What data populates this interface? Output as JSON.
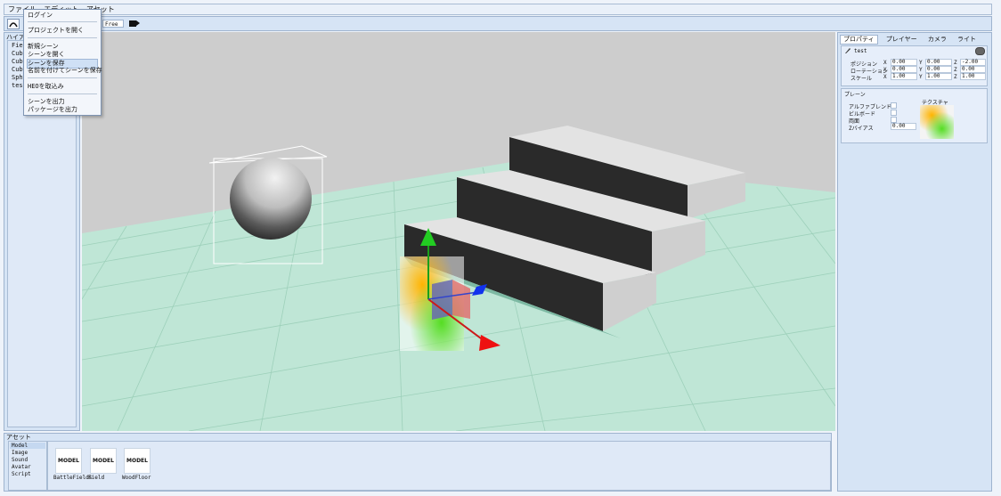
{
  "menubar": {
    "items": [
      "ファイル",
      "エディット",
      "アセット"
    ]
  },
  "toolbar": {
    "camera_mode": "Free"
  },
  "hierarchy": {
    "title": "ハイア",
    "items": [
      "Field",
      "Cube",
      "Cube",
      "Cube",
      "Sphere",
      "test"
    ]
  },
  "file_menu": {
    "items": [
      "ログイン",
      "プロジェクトを開く",
      "新規シーン",
      "シーンを開く",
      "シーンを保存",
      "名前を付けてシーンを保存",
      "HEOを取込み",
      "シーンを出力",
      "パッケージを出力"
    ],
    "selected": "シーンを保存"
  },
  "inspector": {
    "tabs": [
      "プロパティ",
      "プレイヤー",
      "カメラ",
      "ライト"
    ],
    "object_name": "test",
    "transform": {
      "position_label": "ポジション",
      "rotation_label": "ローテーション",
      "scale_label": "スケール",
      "x": "X",
      "y": "Y",
      "z": "Z",
      "position": {
        "x": "0.00",
        "y": "0.00",
        "z": "-2.00"
      },
      "rotation": {
        "x": "0.00",
        "y": "0.00",
        "z": "0.00"
      },
      "scale": {
        "x": "1.00",
        "y": "1.00",
        "z": "1.00"
      }
    },
    "plane": {
      "title": "プレーン",
      "alpha_blend": "アルファブレンド",
      "billboard": "ビルボード",
      "double_sided": "両面",
      "z_bias": "Zバイアス",
      "z_bias_value": "0.00",
      "texture": "テクスチャ"
    }
  },
  "assets": {
    "title": "アセット",
    "categories": [
      "Model",
      "Image",
      "Sound",
      "Avatar",
      "Script"
    ],
    "selected": "Model",
    "items": [
      {
        "badge": "MODEL",
        "name": "BattleFields"
      },
      {
        "badge": "MODEL",
        "name": "Field"
      },
      {
        "badge": "MODEL",
        "name": "WoodFloor"
      }
    ]
  },
  "colors": {
    "floor": "#bfe6d6",
    "grid": "#98cdb6",
    "sky": "#cdcdcd",
    "panel": "#d6e4f5"
  }
}
